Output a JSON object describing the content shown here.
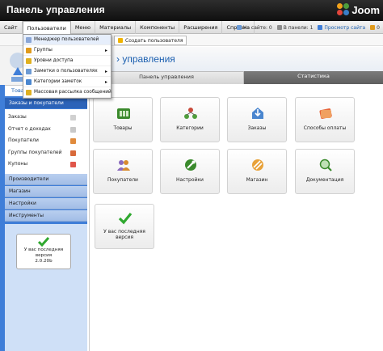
{
  "header": {
    "title": "Панель управления",
    "logo_text": "Joom"
  },
  "menu": {
    "items": [
      "Сайт",
      "Пользователи",
      "Меню",
      "Материалы",
      "Компоненты",
      "Расширения",
      "Справка"
    ]
  },
  "status": {
    "on_site": "На сайте: 0",
    "in_panel": "В панели: 1",
    "preview": "Просмотр сайта",
    "logout": "0"
  },
  "toolbar": {
    "create_user": "Создать пользователя"
  },
  "dropdown": {
    "items": [
      "Менеджер пользователей",
      "Группы",
      "Уровни доступа",
      "Заметки о пользователях",
      "Категории заметок",
      "Массовая рассылка сообщений"
    ]
  },
  "page": {
    "heading": "› управления"
  },
  "sidebar": {
    "tab_label": "Това",
    "section_title": "Заказы и покупатели",
    "items": [
      "Заказы",
      "Отчет о доходах",
      "Покупатели",
      "Группы покупателей",
      "Купоны"
    ],
    "sections": [
      "Производители",
      "Магазин",
      "Настройки",
      "Инструменты"
    ],
    "version_text": [
      "У вас последняя",
      "версия",
      "2.0.20b"
    ]
  },
  "tabs": {
    "panel": "Панель управления",
    "stats": "Статистика"
  },
  "tiles": [
    {
      "label": "Товары",
      "icon": "products-icon"
    },
    {
      "label": "Категории",
      "icon": "categories-icon"
    },
    {
      "label": "Заказы",
      "icon": "orders-icon"
    },
    {
      "label": "Способы оплаты",
      "icon": "payment-icon"
    },
    {
      "label": "Покупатели",
      "icon": "customers-icon"
    },
    {
      "label": "Настройки",
      "icon": "settings-icon"
    },
    {
      "label": "Магазин",
      "icon": "shop-icon"
    },
    {
      "label": "Документация",
      "icon": "docs-icon"
    }
  ],
  "version_tile": {
    "line1": "У вас последняя",
    "line2": "версия"
  },
  "colors": {
    "brand_blue": "#3f7ed8",
    "link": "#1b5fb0",
    "check_green": "#2fa82f"
  }
}
